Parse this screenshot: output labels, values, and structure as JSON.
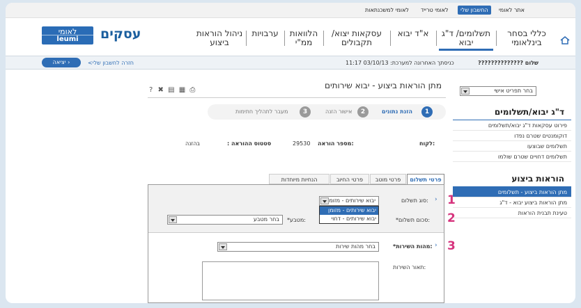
{
  "top_links": {
    "site": "אתר לאומי",
    "my_account": "החשבון שלי",
    "trade": "לאומי טרייד",
    "mortgage": "לאומי למשכנתאות"
  },
  "brand": {
    "logo_he": "לאומי",
    "logo_en": "leumi",
    "name": "עסקים"
  },
  "nav": {
    "item1": "כללי בסחר בינלאומי",
    "item2": "תשלומים/ ד\"ג יבוא",
    "item3": "א\"ד יבוא",
    "item4": "עסקאות יצוא/ תקבולים",
    "item5": "הלוואות ממ\"י",
    "item6": "ערבויות",
    "item7": "ניהול הוראות ביצוע"
  },
  "session": {
    "greeting": "שלום ??????????????",
    "last_login": "כניסתך האחרונה למערכת: 03/10/13 11:17",
    "back_link": "<חזרה לחשבון שלי",
    "exit_label": "יציאה"
  },
  "page": {
    "title": "מתן הוראות ביצוע - יבוא שירותים",
    "toolbar_icons": [
      "print-icon",
      "calculator-icon",
      "save-icon",
      "excel-icon",
      "help-icon"
    ],
    "toolbar_help": "?"
  },
  "steps": [
    {
      "n": "1",
      "label": "הזנת נתונים",
      "active": true
    },
    {
      "n": "2",
      "label": "אישור הזנה",
      "active": false
    },
    {
      "n": "3",
      "label": "מעבר לתהליך חתימות",
      "active": false
    }
  ],
  "info": {
    "customer_label": "לקוח:",
    "order_label": "מספר הוראה:",
    "order_value": "29530",
    "status_label": "סטטוס ההוראה :",
    "status_value": "בהזנה"
  },
  "tabs": [
    "פרטי תשלום",
    "פרטי מוטב",
    "פרטי החיוב",
    "הנחיות מיוחדות"
  ],
  "form": {
    "payment_type_label": "סוג תשלום:",
    "payment_type_value": "יבוא שירותים - מזומ",
    "payment_type_options": [
      "יבוא שירותים - מזומן",
      "יבוא שירותים - דחוי"
    ],
    "amount_label": "*סכום תשלום:",
    "currency_label": "*מטבע:",
    "currency_value": "בחר מטבע",
    "service_label": "*מהות השירות:",
    "service_value": "בחר מהות שירות",
    "service_desc_label": "תאור השירות:"
  },
  "sidebar": {
    "selector": "בחר תפריט אישי",
    "section1_title": "ד\"ג יבוא/תשלומים",
    "section1_items": [
      "פירוט עסקאות ד\"ג יבוא/תשלומים",
      "דוקומנטים שטרם נפדו",
      "תשלומים שבוצעו",
      "תשלומים דחויים שטרם שולמו"
    ],
    "section2_title": "הוראות ביצוע",
    "section2_items": [
      "מתן הוראות ביצוע - תשלומים",
      "מתן הוראות ביצוע יבוא - ד\"ג",
      "טעינת תבנית הוראות"
    ]
  },
  "annotations": [
    "1",
    "2",
    "3"
  ],
  "colors": {
    "accent": "#2f6db5",
    "annotation": "#d6337d"
  }
}
